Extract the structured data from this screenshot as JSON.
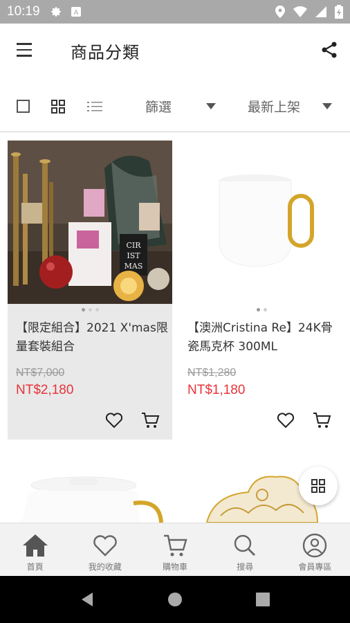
{
  "status_bar": {
    "time": "10:19"
  },
  "header": {
    "title": "商品分類"
  },
  "filters": {
    "filter_label": "篩選",
    "sort_label": "最新上架"
  },
  "products": [
    {
      "name": "【限定組合】2021 X'mas限量套裝組合",
      "old_price": "NT$7,000",
      "price": "NT$2,180",
      "image_pages": 3,
      "active_page": 1
    },
    {
      "name": "【澳洲Cristina Re】24K骨瓷馬克杯 300ML",
      "old_price": "NT$1,280",
      "price": "NT$1,180",
      "image_pages": 2,
      "active_page": 1
    }
  ],
  "bottom_nav": [
    {
      "label": "首頁",
      "icon": "home-icon"
    },
    {
      "label": "我的收藏",
      "icon": "heart-icon"
    },
    {
      "label": "購物車",
      "icon": "cart-icon"
    },
    {
      "label": "搜尋",
      "icon": "search-icon"
    },
    {
      "label": "會員專區",
      "icon": "user-icon"
    }
  ],
  "colors": {
    "price_red": "#e8333a",
    "gold": "#d4a52a",
    "nav_bg": "#f2f2f2",
    "status_bar": "#a9a9a9"
  }
}
